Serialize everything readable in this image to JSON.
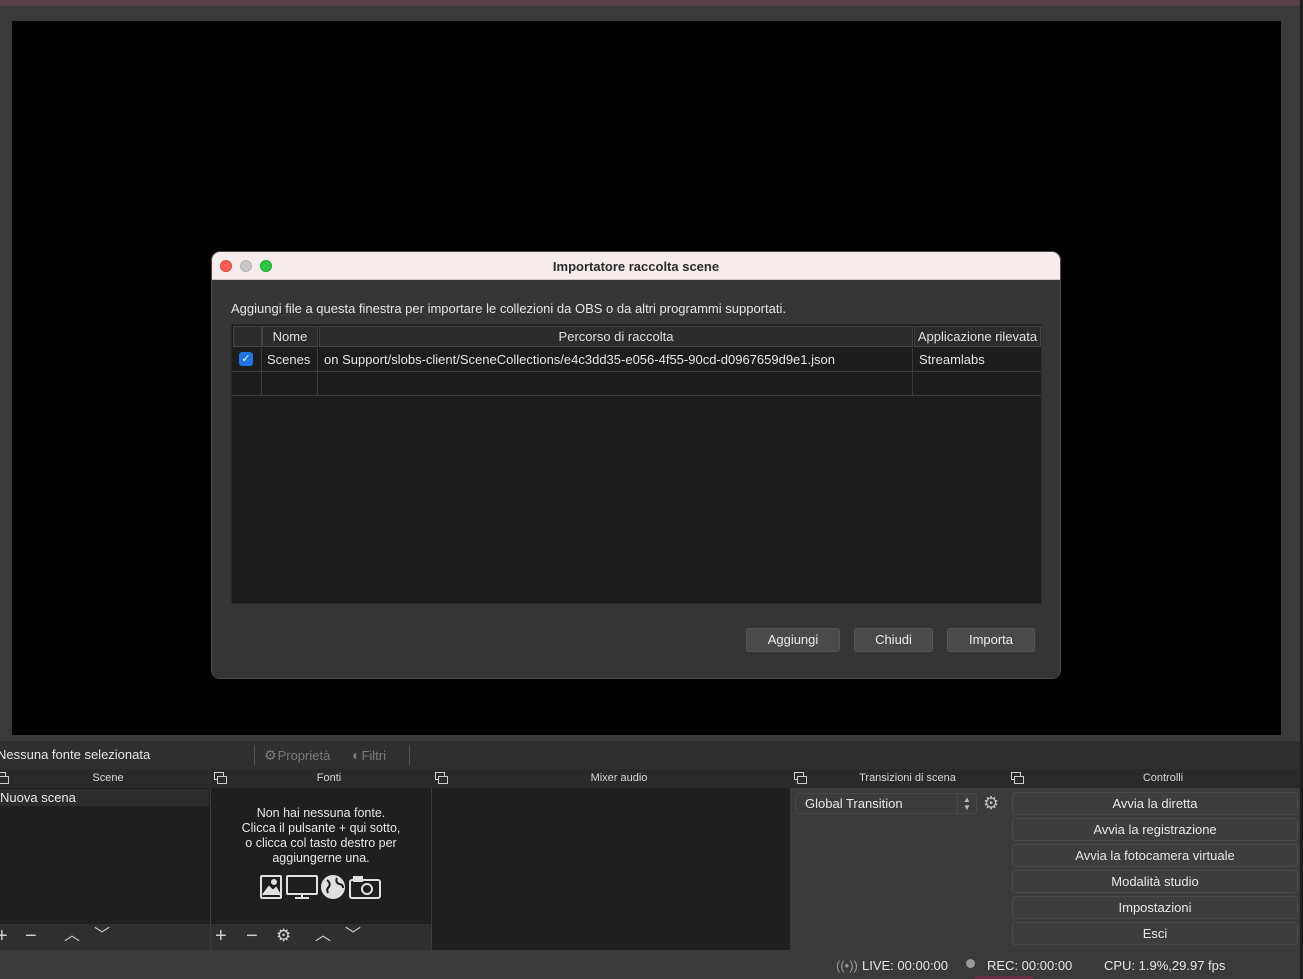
{
  "dialog": {
    "title": "Importatore raccolta scene",
    "description": "Aggiungi file a questa finestra per importare le collezioni da OBS o da altri programmi supportati.",
    "columns": [
      "",
      "Nome",
      "Percorso di raccolta",
      "Applicazione rilevata"
    ],
    "rows": [
      {
        "checked": true,
        "name": "Scenes",
        "path": "on Support/slobs-client/SceneCollections/e4c3dd35-e056-4f55-90cd-d0967659d9e1.json",
        "browse_label": "...",
        "app": "Streamlabs"
      }
    ],
    "buttons": {
      "add": "Aggiungi",
      "close": "Chiudi",
      "import": "Importa"
    }
  },
  "context_bar": {
    "no_source": "Nessuna fonte selezionata",
    "properties": "Proprietà",
    "filters": "Filtri"
  },
  "docks": {
    "scenes": {
      "title": "Scene",
      "items": [
        "Nuova scena"
      ]
    },
    "sources": {
      "title": "Fonti",
      "empty_line1": "Non hai nessuna fonte.",
      "empty_line2": "Clicca il pulsante + qui sotto,",
      "empty_line3": "o clicca col tasto destro per",
      "empty_line4": "aggiungerne una."
    },
    "mixer": {
      "title": "Mixer audio"
    },
    "transitions": {
      "title": "Transizioni di scena",
      "selected": "Global Transition"
    },
    "controls": {
      "title": "Controlli",
      "buttons": [
        "Avvia la diretta",
        "Avvia la registrazione",
        "Avvia la fotocamera virtuale",
        "Modalità studio",
        "Impostazioni",
        "Esci"
      ]
    }
  },
  "status": {
    "live": "LIVE: 00:00:00",
    "rec": "REC: 00:00:00",
    "cpu": "CPU: 1.9%,29.97 fps"
  }
}
